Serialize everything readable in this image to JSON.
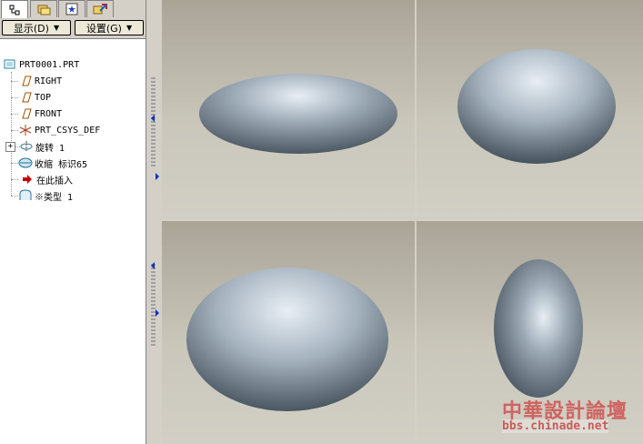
{
  "toolbar": {
    "show_label": "显示(D)",
    "settings_label": "设置(G)"
  },
  "tree": {
    "items": [
      {
        "label": "PRT0001.PRT",
        "icon": "part-icon"
      },
      {
        "label": "RIGHT",
        "icon": "datum-plane-icon"
      },
      {
        "label": "TOP",
        "icon": "datum-plane-icon"
      },
      {
        "label": "FRONT",
        "icon": "datum-plane-icon"
      },
      {
        "label": "PRT_CSYS_DEF",
        "icon": "coordinate-system-icon"
      },
      {
        "label": "旋转 1",
        "icon": "revolve-feature-icon"
      },
      {
        "label": "收缩 标识65",
        "icon": "shrink-feature-icon"
      },
      {
        "label": "在此插入",
        "icon": "insert-here-arrow-icon"
      },
      {
        "label": "※类型 1",
        "icon": "style-feature-icon"
      }
    ]
  },
  "watermark": {
    "title": "中華設計論壇",
    "url": "bbs.chinade.net"
  },
  "colors": {
    "viewport_top": "#a9a496",
    "viewport_bottom": "#d2d0c6",
    "shape_light": "#e8eef4",
    "shape_dark": "#46525c"
  }
}
